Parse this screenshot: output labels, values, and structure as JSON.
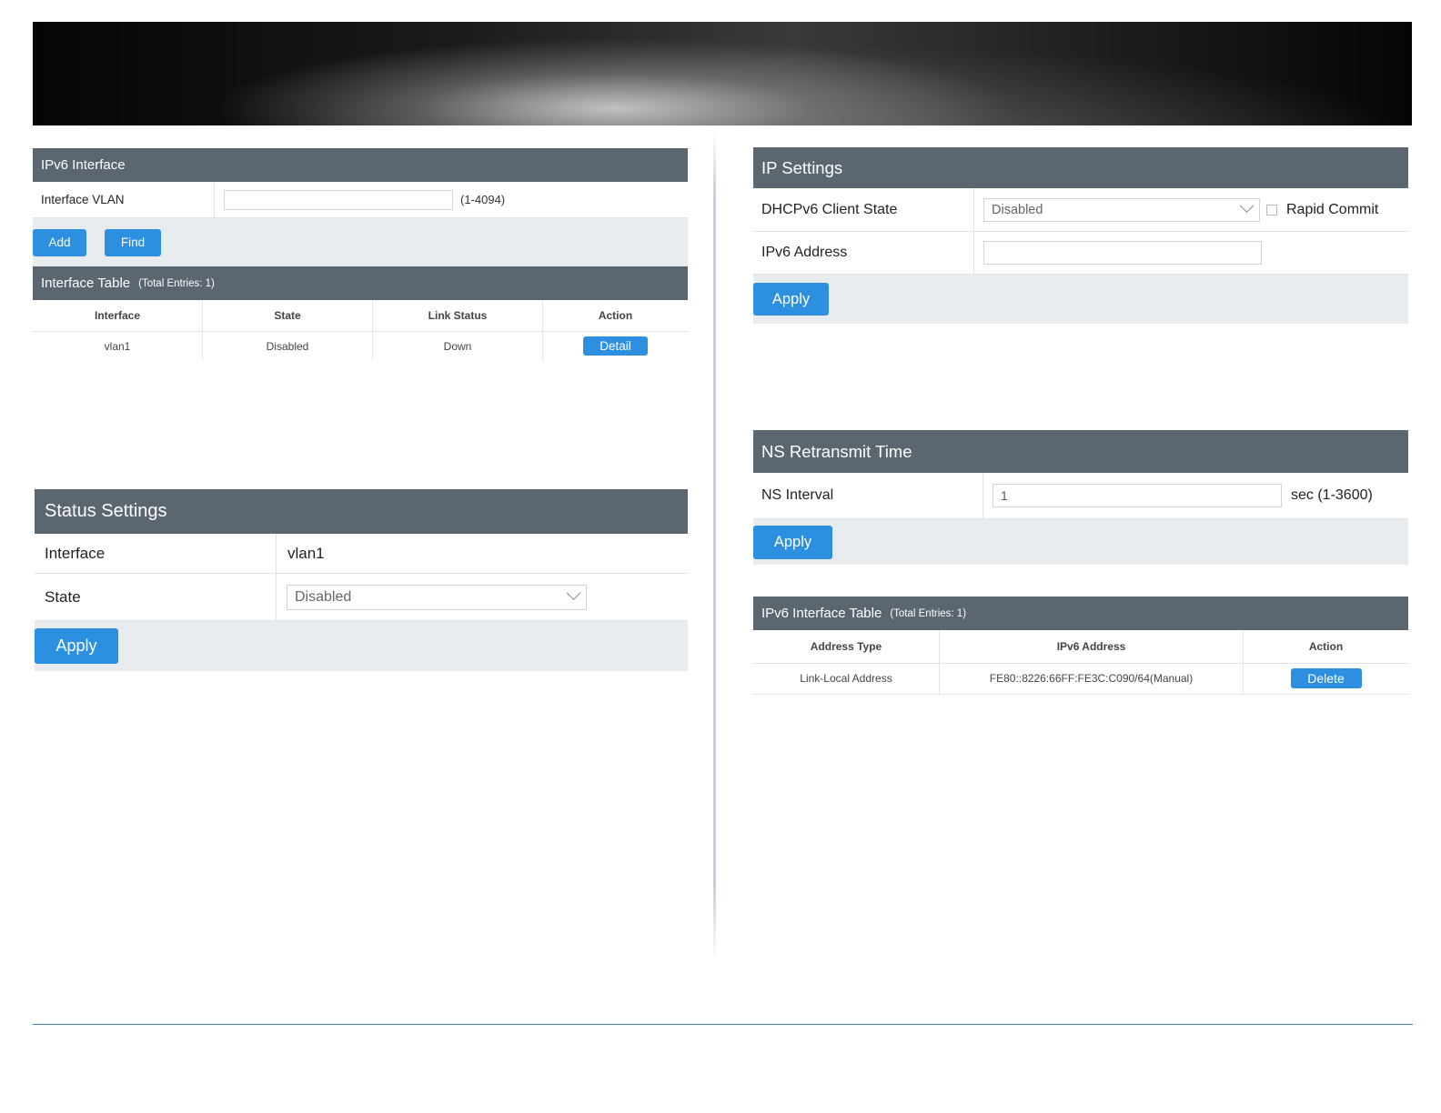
{
  "ipv6_interface": {
    "title": "IPv6 Interface",
    "vlan_label": "Interface VLAN",
    "vlan_value": "",
    "vlan_range": "(1-4094)",
    "add_label": "Add",
    "find_label": "Find"
  },
  "interface_table": {
    "title": "Interface Table",
    "subtitle": "(Total Entries: 1)",
    "columns": [
      "Interface",
      "State",
      "Link Status",
      "Action"
    ],
    "rows": [
      {
        "interface": "vlan1",
        "state": "Disabled",
        "link_status": "Down",
        "action": "Detail"
      }
    ]
  },
  "status_settings": {
    "title": "Status Settings",
    "interface_label": "Interface",
    "interface_value": "vlan1",
    "state_label": "State",
    "state_value": "Disabled",
    "apply_label": "Apply"
  },
  "ip_settings": {
    "title": "IP Settings",
    "dhcp_label": "DHCPv6 Client State",
    "dhcp_value": "Disabled",
    "rapid_commit_label": "Rapid Commit",
    "ipv6_address_label": "IPv6 Address",
    "ipv6_address_value": "",
    "apply_label": "Apply"
  },
  "ns_retransmit": {
    "title": "NS Retransmit Time",
    "interval_label": "NS Interval",
    "interval_value": "1",
    "interval_unit": "sec (1-3600)",
    "apply_label": "Apply"
  },
  "ipv6_interface_table": {
    "title": "IPv6 Interface Table",
    "subtitle": "(Total Entries: 1)",
    "columns": [
      "Address Type",
      "IPv6 Address",
      "Action"
    ],
    "rows": [
      {
        "address_type": "Link-Local Address",
        "ipv6_address": "FE80::8226:66FF:FE3C:C090/64(Manual)",
        "action": "Delete"
      }
    ]
  },
  "colors": {
    "header": "#5c6670",
    "button": "#2d8fe0",
    "button_bar": "#e9ecef",
    "footer_line": "#3a78b8"
  }
}
